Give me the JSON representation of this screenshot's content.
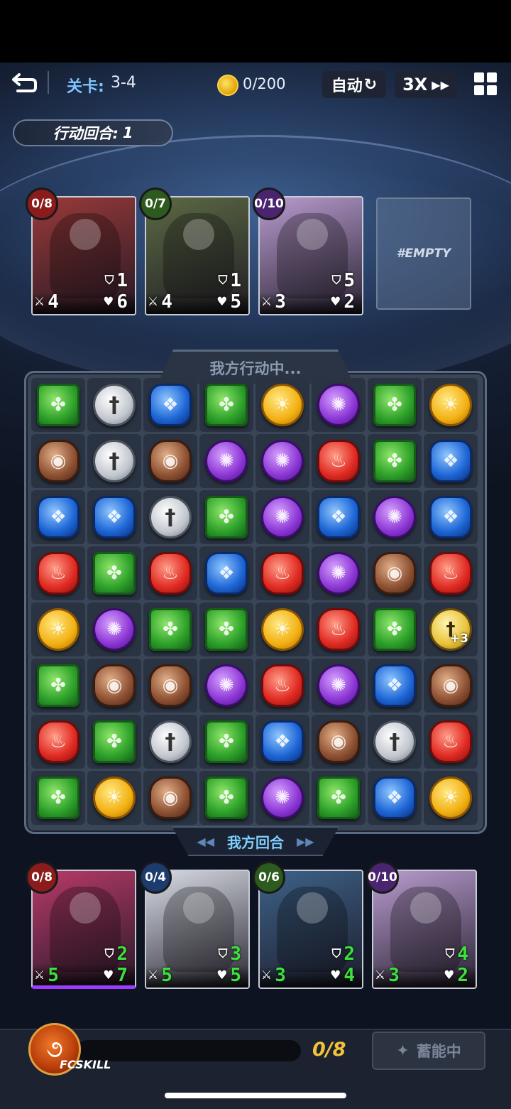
{
  "topbar": {
    "level_label": "关卡:",
    "level_value": "3-4",
    "coins": "0/200",
    "auto_label": "自动",
    "speed_label": "3X"
  },
  "turn_banner": {
    "label": "行动回合:",
    "value": "1"
  },
  "enemy_cards": [
    {
      "badge": "0/8",
      "badge_color": "red",
      "shield": "1",
      "attack": "4",
      "hp": "6",
      "art": "#9a3a3a"
    },
    {
      "badge": "0/7",
      "badge_color": "green",
      "shield": "1",
      "attack": "4",
      "hp": "5",
      "art": "#5c6a44"
    },
    {
      "badge": "0/10",
      "badge_color": "purple",
      "shield": "5",
      "attack": "3",
      "hp": "2",
      "art": "#b99ccf"
    }
  ],
  "empty_slot": "#EMPTY",
  "board": {
    "header": "我方行动中...",
    "footer": "我方回合",
    "rows": [
      [
        "green",
        "sword",
        "blue",
        "green",
        "yellow",
        "purple",
        "green",
        "yellow"
      ],
      [
        "brown",
        "sword",
        "brown",
        "purple",
        "purple",
        "red",
        "green",
        "blue"
      ],
      [
        "blue",
        "blue",
        "sword",
        "green",
        "purple",
        "blue",
        "purple",
        "blue"
      ],
      [
        "red",
        "green",
        "red",
        "blue",
        "red",
        "purple",
        "brown",
        "red"
      ],
      [
        "yellow",
        "purple",
        "green",
        "green",
        "yellow",
        "red",
        "green",
        "gold-sword"
      ],
      [
        "green",
        "brown",
        "brown",
        "purple",
        "red",
        "purple",
        "blue",
        "brown"
      ],
      [
        "red",
        "green",
        "sword",
        "green",
        "blue",
        "brown",
        "sword",
        "red"
      ],
      [
        "green",
        "yellow",
        "brown",
        "green",
        "purple",
        "green",
        "blue",
        "yellow"
      ]
    ],
    "bonus_label": "+3"
  },
  "player_cards": [
    {
      "badge": "0/8",
      "badge_color": "red",
      "shield": "2",
      "attack": "5",
      "hp": "7",
      "art": "#b83a6a"
    },
    {
      "badge": "0/4",
      "badge_color": "blue",
      "shield": "3",
      "attack": "5",
      "hp": "5",
      "art": "#d9dde6"
    },
    {
      "badge": "0/6",
      "badge_color": "green",
      "shield": "2",
      "attack": "3",
      "hp": "4",
      "art": "#3d6288"
    },
    {
      "badge": "0/10",
      "badge_color": "purple",
      "shield": "4",
      "attack": "3",
      "hp": "2",
      "art": "#b99ccf"
    }
  ],
  "skill": {
    "label": "FCSKILL",
    "count": "0/8",
    "progress": 0,
    "charge_label": "蓄能中"
  },
  "colors": {
    "accent_blue": "#7fc4ff",
    "player_stat_green": "#3be23b",
    "skill_gold": "#f2c23a"
  }
}
